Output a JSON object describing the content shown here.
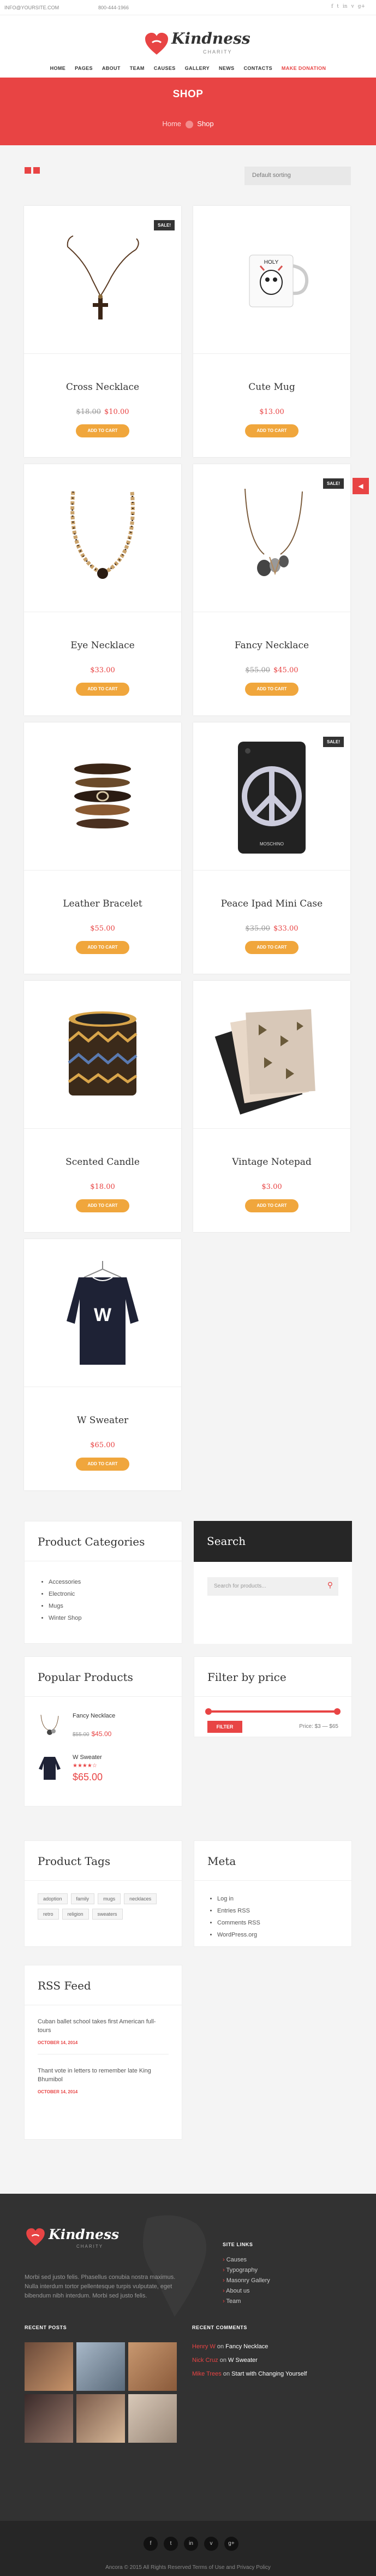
{
  "topbar": {
    "email": "INFO@YOURSITE.COM",
    "phone": "800-444-1966",
    "social": [
      "f",
      "t",
      "in",
      "v",
      "g+"
    ]
  },
  "logo": {
    "name": "Kindness",
    "sub": "CHARITY"
  },
  "nav": [
    "HOME",
    "PAGES",
    "ABOUT",
    "TEAM",
    "CAUSES",
    "GALLERY",
    "NEWS",
    "CONTACTS"
  ],
  "nav_cta": "MAKE DONATION",
  "banner": {
    "title": "SHOP",
    "crumb_home": "Home",
    "crumb_current": "Shop"
  },
  "sort": {
    "value": "Default sorting"
  },
  "products": [
    {
      "name": "Cross Necklace",
      "old": "$18.00",
      "price": "$10.00",
      "sale": "SALE!",
      "button": "ADD TO CART"
    },
    {
      "name": "Cute Mug",
      "old": "",
      "price": "$13.00",
      "sale": "",
      "button": "ADD TO CART"
    },
    {
      "name": "Eye Necklace",
      "old": "",
      "price": "$33.00",
      "sale": "",
      "button": "ADD TO CART"
    },
    {
      "name": "Fancy Necklace",
      "old": "$55.00",
      "price": "$45.00",
      "sale": "SALE!",
      "button": "ADD TO CART"
    },
    {
      "name": "Leather Bracelet",
      "old": "",
      "price": "$55.00",
      "sale": "",
      "button": "ADD TO CART"
    },
    {
      "name": "Peace Ipad Mini Case",
      "old": "$35.00",
      "price": "$33.00",
      "sale": "SALE!",
      "button": "ADD TO CART"
    },
    {
      "name": "Scented Candle",
      "old": "",
      "price": "$18.00",
      "sale": "",
      "button": "ADD TO CART"
    },
    {
      "name": "Vintage Notepad",
      "old": "",
      "price": "$3.00",
      "sale": "",
      "button": "ADD TO CART"
    },
    {
      "name": "W Sweater",
      "old": "",
      "price": "$65.00",
      "sale": "",
      "button": "ADD TO CART"
    }
  ],
  "mug_text": "HOLY",
  "case_text": "MOSCHINO",
  "sweater_letter": "W",
  "widgets": {
    "categories": {
      "title": "Product Categories",
      "items": [
        "Accessories",
        "Electronic",
        "Mugs",
        "Winter Shop"
      ]
    },
    "search": {
      "title": "Search",
      "placeholder": "Search for products..."
    },
    "popular": {
      "title": "Popular Products",
      "items": [
        {
          "name": "Fancy Necklace",
          "old": "$55.00",
          "price": "$45.00"
        },
        {
          "name": "W Sweater",
          "price": "$65.00",
          "stars": "★★★★☆"
        }
      ]
    },
    "popular_stars": "★★★★★",
    "filter": {
      "title": "Filter by price",
      "button": "FILTER",
      "range": "Price: $3 — $65"
    },
    "tags": {
      "title": "Product Tags",
      "items": [
        "adoption",
        "family",
        "mugs",
        "necklaces",
        "retro",
        "religion",
        "sweaters"
      ]
    },
    "meta": {
      "title": "Meta",
      "items": [
        "Log in",
        "Entries RSS",
        "Comments RSS",
        "WordPress.org"
      ]
    },
    "rss": {
      "title": "RSS Feed",
      "items": [
        {
          "text": "Cuban ballet school takes first American full-tours",
          "date": "OCTOBER 14, 2014"
        },
        {
          "text": "Thant vote in letters to remember late King Bhumibol",
          "date": "OCTOBER 14, 2014"
        }
      ]
    }
  },
  "footer": {
    "text": "Morbi sed justo felis. Phasellus conubia nostra maximus. Nulla interdum tortor pellentesque turpis vulputate, eget bibendum nibh interdum. Morbi sed justo felis.",
    "links_title": "SITE LINKS",
    "links": [
      "Causes",
      "Typography",
      "Masonry Gallery",
      "About us",
      "Team"
    ],
    "recent_posts_title": "RECENT POSTS",
    "recent_comments_title": "RECENT COMMENTS",
    "comments": [
      {
        "who": "Henry W",
        "on": "on",
        "post": "Fancy Necklace"
      },
      {
        "who": "Nick Cruz",
        "on": "on",
        "post": "W Sweater"
      },
      {
        "who": "Mike Trees",
        "on": "on",
        "post": "Start with Changing Yourself"
      }
    ],
    "copyright": "Ancora © 2015 All Rights Reserved Terms of Use and Privacy Policy"
  },
  "colors": {
    "accent": "#e84444",
    "button": "#f0a63c",
    "dark": "#323232"
  }
}
